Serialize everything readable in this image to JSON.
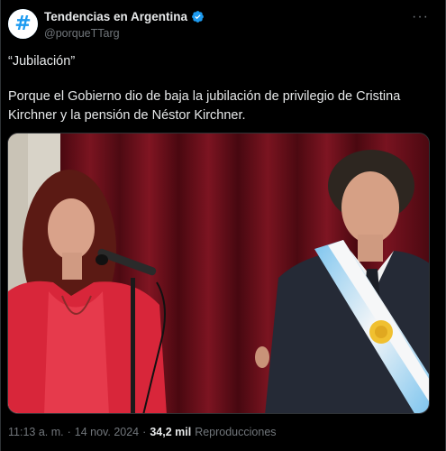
{
  "account": {
    "display_name": "Tendencias en Argentina",
    "handle": "@porqueTTarg",
    "avatar_glyph": "#",
    "verified_color": "#1d9bf0"
  },
  "more_icon": "more-options-icon",
  "more_glyph": "···",
  "tweet": {
    "title_line": "“Jubilación”",
    "body": "Porque el Gobierno dio de baja la jubilación de privilegio de Cristina Kirchner y la pensión de Néstor Kirchner."
  },
  "media": {
    "description_icon": "photo-image"
  },
  "meta": {
    "time": "11:13 a. m.",
    "separator": "·",
    "date": "14 nov. 2024",
    "separator2": "·",
    "views": "34,2 mil",
    "views_label": "Reproducciones"
  },
  "colors": {
    "background": "#000000",
    "text": "#e7e9ea",
    "muted": "#71767b",
    "accent": "#1d9bf0"
  }
}
